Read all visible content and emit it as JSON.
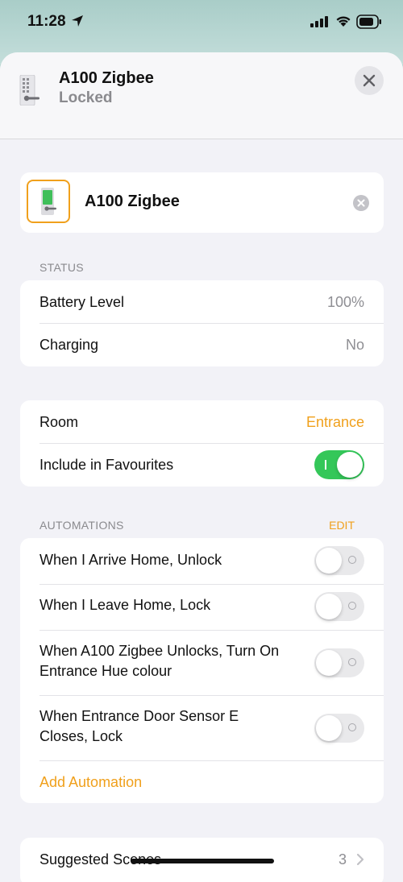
{
  "status_bar": {
    "time": "11:28"
  },
  "header": {
    "title": "A100 Zigbee",
    "subtitle": "Locked"
  },
  "device": {
    "name": "A100 Zigbee"
  },
  "status_section": {
    "label": "STATUS",
    "rows": [
      {
        "label": "Battery Level",
        "value": "100%"
      },
      {
        "label": "Charging",
        "value": "No"
      }
    ]
  },
  "settings": {
    "room_label": "Room",
    "room_value": "Entrance",
    "favourites_label": "Include in Favourites",
    "favourites_on": true
  },
  "automations": {
    "label": "AUTOMATIONS",
    "edit_label": "EDIT",
    "items": [
      {
        "label": "When I Arrive Home, Unlock",
        "on": false
      },
      {
        "label": "When I Leave Home, Lock",
        "on": false
      },
      {
        "label": "When A100 Zigbee Unlocks, Turn On Entrance Hue colour",
        "on": false
      },
      {
        "label": "When Entrance Door Sensor E Closes, Lock",
        "on": false
      }
    ],
    "add_label": "Add Automation"
  },
  "suggested": {
    "label": "Suggested Scenes",
    "count": "3"
  },
  "colors": {
    "accent": "#f0a01c",
    "toggle_on": "#34c759"
  },
  "icons": [
    "location-arrow-icon",
    "signal-icon",
    "wifi-icon",
    "battery-icon",
    "lock-icon",
    "close-icon",
    "clear-icon",
    "chevron-right-icon"
  ]
}
